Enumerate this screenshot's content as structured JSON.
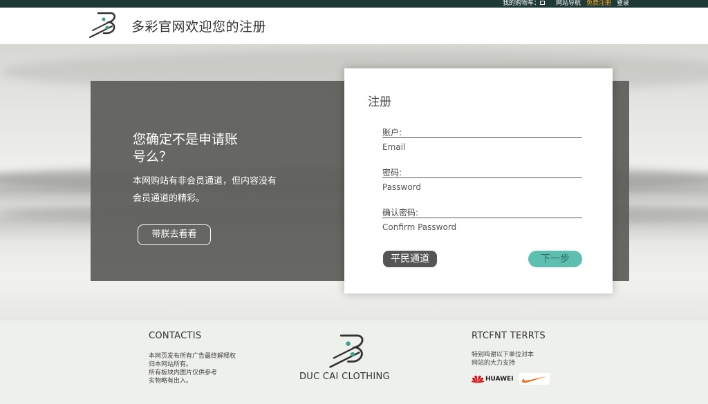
{
  "topbar": {
    "links": [
      "我的购物车：",
      "网站导航",
      "免费注册",
      "登录"
    ],
    "cart_icon": "cart-icon",
    "highlight_color": "#f5a623",
    "bg_color": "#1f3a36"
  },
  "header": {
    "title": "多彩官网欢迎您的注册",
    "logo_icon": "brand-logo-icon"
  },
  "promo": {
    "title": "您确定不是申请账号么？",
    "text": "本网购站有非会员通道，但内容没有会员通道的精彩。",
    "button_label": "带朕去看看"
  },
  "form": {
    "title": "注册",
    "fields": [
      {
        "label": "账户:",
        "placeholder": "Email"
      },
      {
        "label": "密码:",
        "placeholder": "Password"
      },
      {
        "label": "确认密码:",
        "placeholder": "Confirm Password"
      }
    ],
    "plain_button": "平民通道",
    "next_button": "下一步",
    "accent_color": "#5ebfb1"
  },
  "footer": {
    "contact": {
      "heading": "CONTACTIS",
      "lines": [
        "本网页发布所有广告最终解释权",
        "归本网站所有。",
        "所有板块内图片仅供参考",
        "实物略有出入。"
      ]
    },
    "brand": {
      "name": "DUC CAI CLOTHING",
      "logo_icon": "brand-logo-icon"
    },
    "partners": {
      "heading": "RTCFNT  TERRTS",
      "lines": [
        "特别鸣谢以下单位对本",
        "网站的大力支持"
      ],
      "sponsor_huawei": "HUAWEI",
      "sponsor_nike_icon": "nike-swoosh-icon"
    }
  }
}
